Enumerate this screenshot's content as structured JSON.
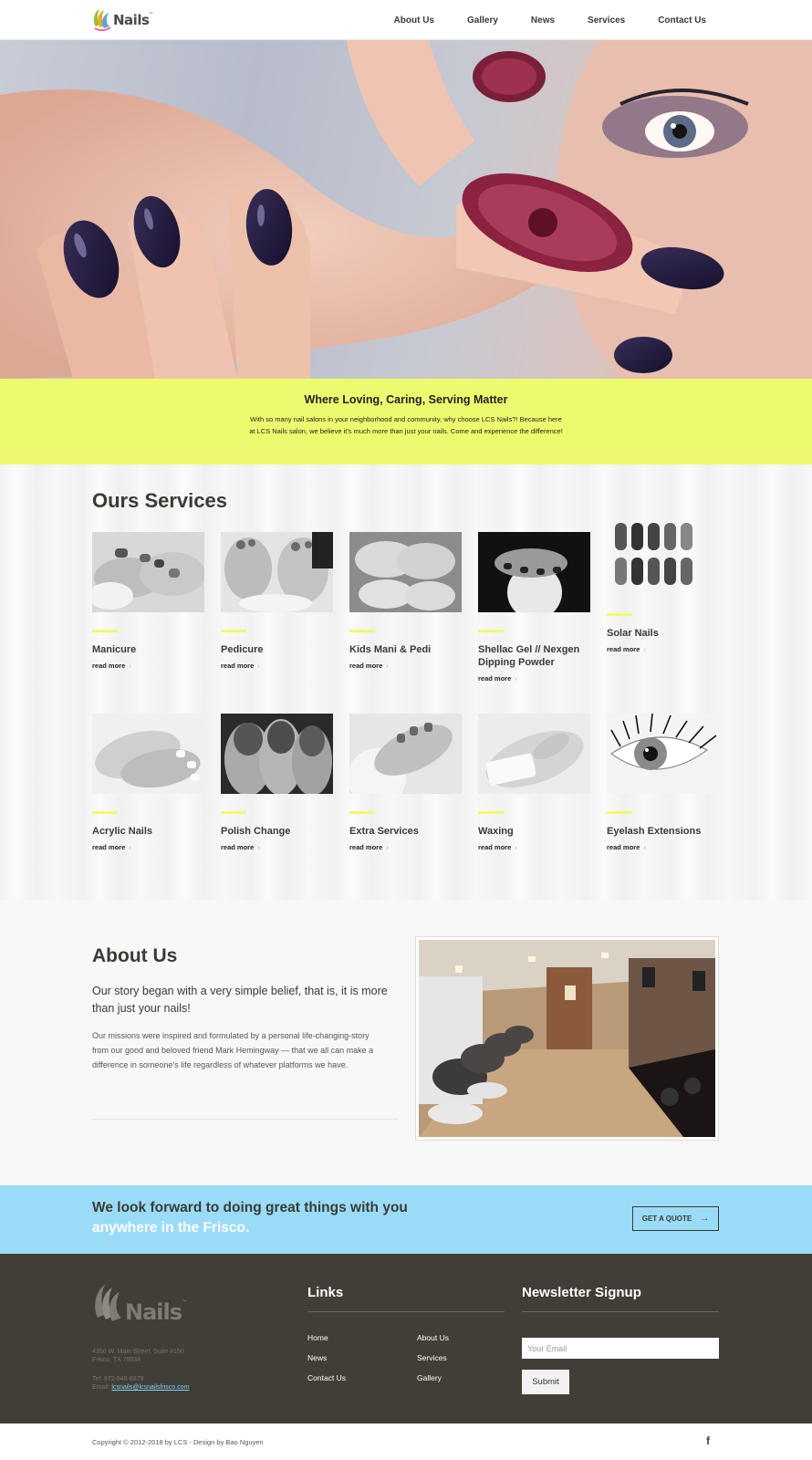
{
  "header": {
    "logo_text": "Nails",
    "logo_tm": "™",
    "nav": [
      "About Us",
      "Gallery",
      "News",
      "Services",
      "Contact Us"
    ]
  },
  "tagline": {
    "title": "Where Loving, Caring, Serving Matter",
    "text": "With so many nail salons in your neighborhood and community, why choose LCS Nails?! Because here at LCS Nails salon, we believe it's much more than just your nails. Come and experience the difference!"
  },
  "services": {
    "heading": "Ours Services",
    "read_more": "read more",
    "items": [
      {
        "title": "Manicure"
      },
      {
        "title": "Pedicure"
      },
      {
        "title": "Kids Mani & Pedi"
      },
      {
        "title": "Shellac Gel // Nexgen Dipping Powder"
      },
      {
        "title": "Solar Nails"
      },
      {
        "title": "Acrylic Nails"
      },
      {
        "title": "Polish Change"
      },
      {
        "title": "Extra Services"
      },
      {
        "title": "Waxing"
      },
      {
        "title": "Eyelash Extensions"
      }
    ]
  },
  "about": {
    "heading": "About Us",
    "lead": "Our story began with a very simple belief, that is, it is more than just your nails!",
    "body_lines": [
      "Our missions were inspired and formulated by a personal life-changing-story",
      "from our good and beloved friend Mark Hemingway — that we all can make a",
      "difference in someone's life regardless of whatever platforms we have."
    ]
  },
  "cta": {
    "line1": "We look forward to doing great things with you",
    "line2": "anywhere in the Frisco.",
    "button": "GET A QUOTE"
  },
  "footer": {
    "logo_text": "Nails",
    "address_line1": "4350 W. Main Street, Suite #150",
    "address_line2": "Frisco, TX 75034",
    "tel": "Tel: 972-546-8879",
    "email_label": "Email:",
    "email": "lcsnails@lcsnailsfrisco.com",
    "links_heading": "Links",
    "links": [
      "Home",
      "About Us",
      "News",
      "Services",
      "Contact Us",
      "Gallery"
    ],
    "newsletter_heading": "Newsletter Signup",
    "email_placeholder": "Your Email",
    "submit": "Submit"
  },
  "bottom": {
    "copyright": "Copyright © 2012-2018 by LCS - Design by Bao Nguyen",
    "social_icon": "f"
  },
  "colors": {
    "accent_yellow": "#eefa6e",
    "cta_blue": "#9adcf7",
    "footer_bg": "#413e36",
    "text_dark": "#3b3a34"
  }
}
